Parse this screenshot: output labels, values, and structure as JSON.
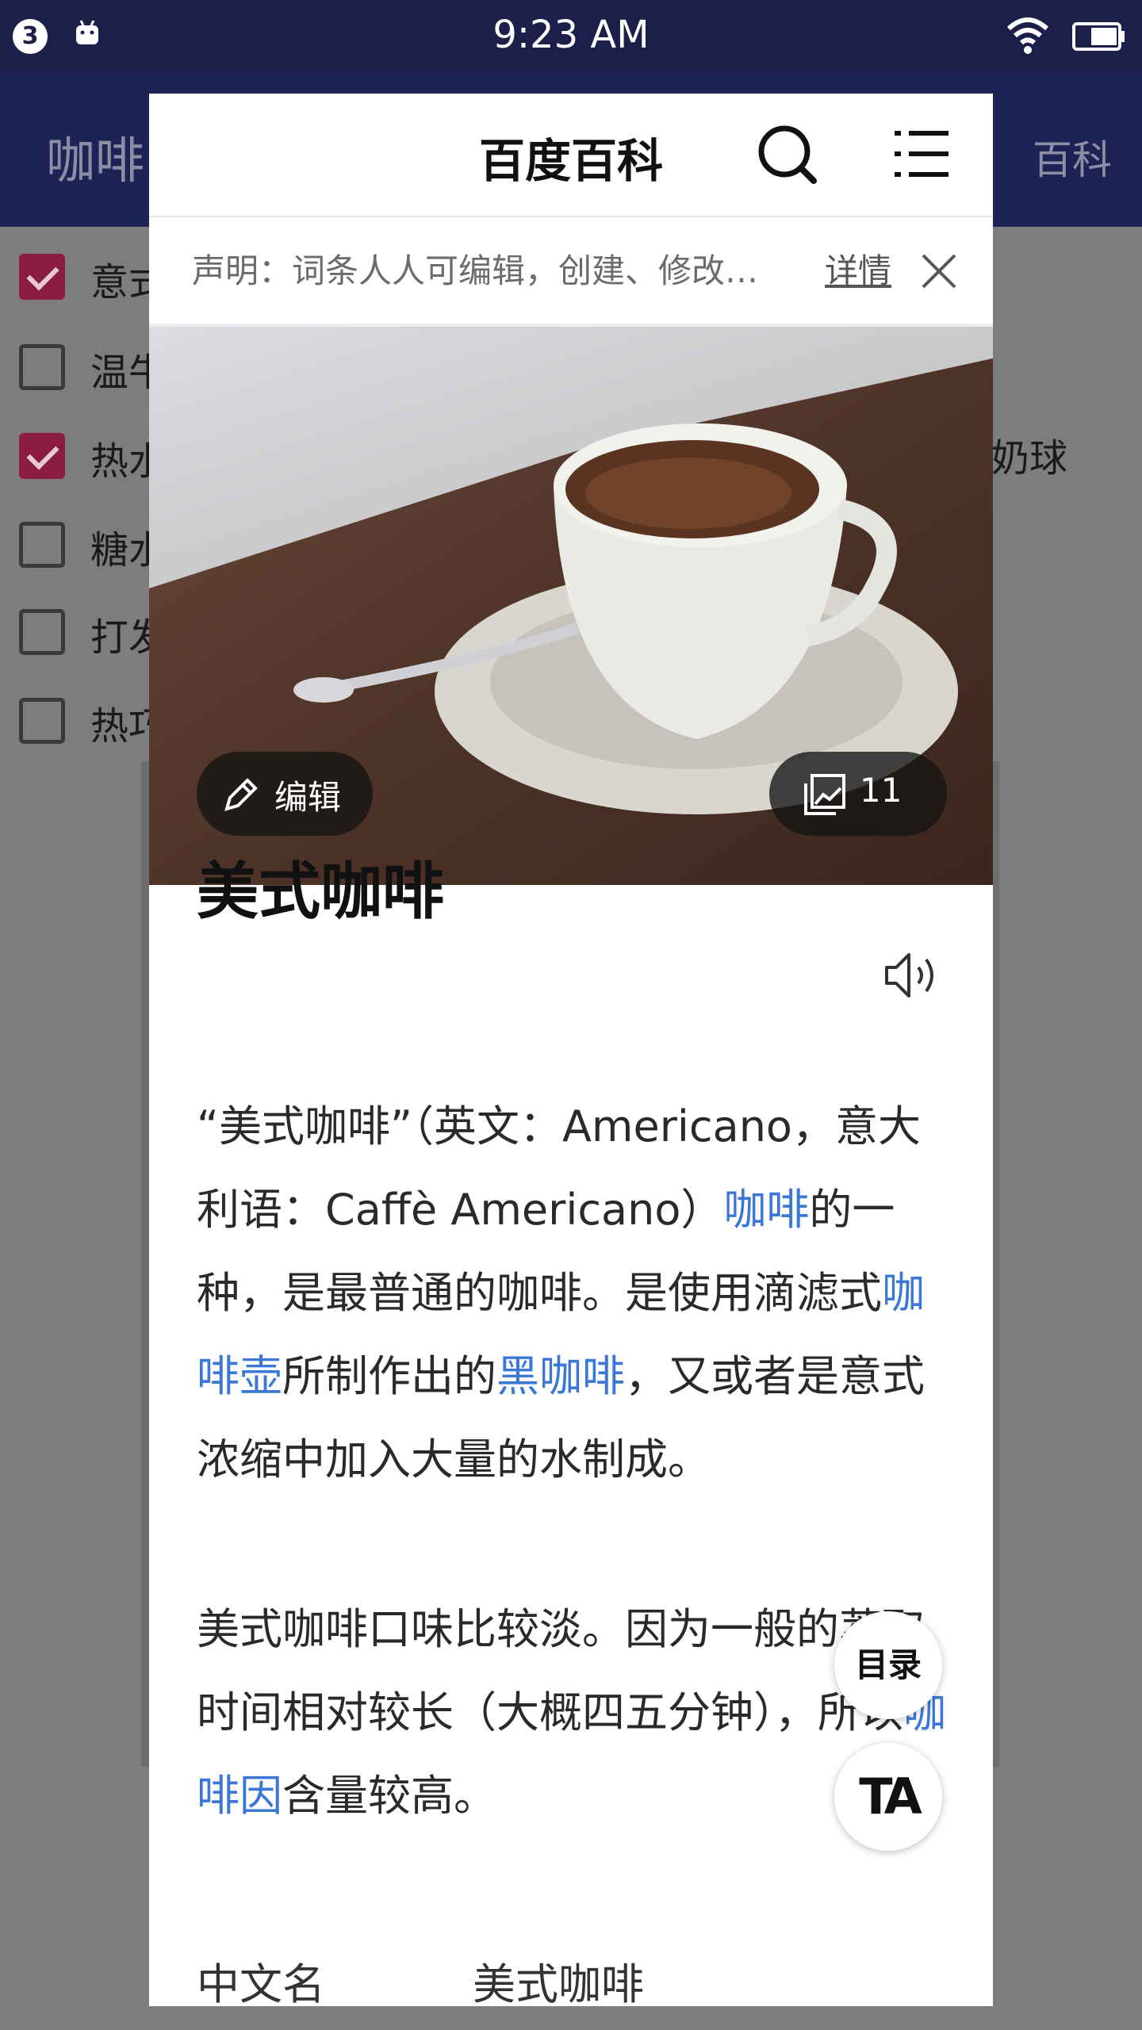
{
  "status_bar": {
    "notification_count": "3",
    "time": "9:23 AM"
  },
  "background_app": {
    "title": "咖啡",
    "header_right": "百科",
    "items": [
      {
        "label": "意式",
        "checked": true
      },
      {
        "label": "温牛",
        "checked": false
      },
      {
        "label": "热水",
        "checked": true
      },
      {
        "label": "糖水",
        "checked": false
      },
      {
        "label": "打发",
        "checked": false
      },
      {
        "label": "热巧",
        "checked": false
      }
    ],
    "right_text": "奶球"
  },
  "baike": {
    "nav_title": "百度百科",
    "notice": {
      "text": "声明：词条人人可编辑，创建、修改…",
      "link": "详情"
    },
    "hero": {
      "edit_label": "编辑",
      "gallery_count": "11"
    },
    "article": {
      "title": "美式咖啡",
      "paragraph1": [
        {
          "text": "“美式咖啡”（英文：Americano，意大利语：Caffè Americano）",
          "link": false
        },
        {
          "text": "咖啡",
          "link": true
        },
        {
          "text": "的一种，是最普通的咖啡。是使用滴滤式",
          "link": false
        },
        {
          "text": "咖啡壶",
          "link": true
        },
        {
          "text": "所制作出的",
          "link": false
        },
        {
          "text": "黑咖啡",
          "link": true
        },
        {
          "text": "，又或者是意式浓缩中加入大量的水制成。",
          "link": false
        }
      ],
      "paragraph2": [
        {
          "text": "美式咖啡口味比较淡。因为一般的萃取时间相对较长（大概四五分钟），所以",
          "link": false
        },
        {
          "text": "咖啡因",
          "link": true
        },
        {
          "text": "含量较高。",
          "link": false
        }
      ],
      "info": {
        "key": "中文名",
        "value": "美式咖啡"
      }
    },
    "fab_toc": "目录",
    "fab_font": "TA"
  }
}
